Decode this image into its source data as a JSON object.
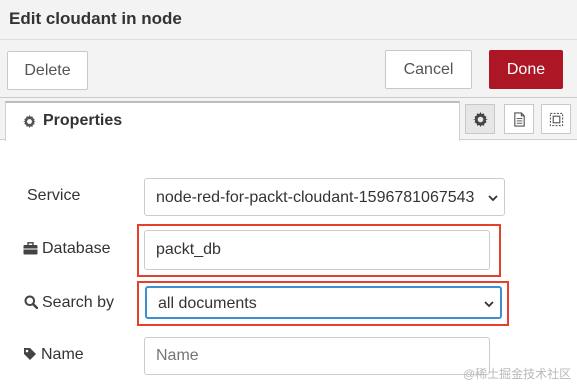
{
  "dialog": {
    "title": "Edit cloudant in node"
  },
  "actions": {
    "delete_label": "Delete",
    "cancel_label": "Cancel",
    "done_label": "Done"
  },
  "tabs": {
    "properties_label": "Properties"
  },
  "form": {
    "service": {
      "label": "Service",
      "value": "node-red-for-packt-cloudant-1596781067543"
    },
    "database": {
      "label": "Database",
      "value": "packt_db"
    },
    "search_by": {
      "label": "Search by",
      "value": "all documents"
    },
    "name": {
      "label": "Name",
      "placeholder": "Name"
    }
  },
  "watermark": "@稀土掘金技术社区",
  "colors": {
    "done_button": "#ad1625",
    "highlight_border": "#e5402b",
    "focus_border": "#3d8fd1"
  }
}
